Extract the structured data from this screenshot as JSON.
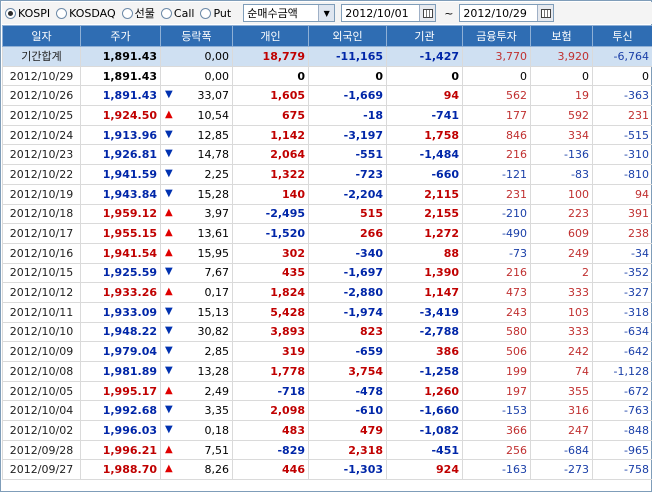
{
  "toolbar": {
    "radios": [
      {
        "label": "KOSPI",
        "selected": true
      },
      {
        "label": "KOSDAQ",
        "selected": false
      },
      {
        "label": "선물",
        "selected": false
      },
      {
        "label": "Call",
        "selected": false
      },
      {
        "label": "Put",
        "selected": false
      }
    ],
    "select_value": "순매수금액",
    "date_from": "2012/10/01",
    "tilde": "~",
    "date_to": "2012/10/29"
  },
  "colors": {
    "header_bg": "#2f6db3",
    "up": "#c00000",
    "down": "#0026a8",
    "sum_bg": "#cfe0f2"
  },
  "columns": [
    "일자",
    "주가",
    "등락폭",
    "개인",
    "외국인",
    "기관",
    "금융투자",
    "보험",
    "투신"
  ],
  "rows": [
    {
      "date": "기간합계",
      "price": "1,891.43",
      "dir": "",
      "change": "0,00",
      "indiv": "18,779",
      "foreign": "-11,165",
      "inst": "-1,427",
      "fin": "3,770",
      "ins": "3,920",
      "trust": "-6,764",
      "sum": true
    },
    {
      "date": "2012/10/29",
      "price": "1,891.43",
      "dir": "",
      "change": "0,00",
      "indiv": "0",
      "foreign": "0",
      "inst": "0",
      "fin": "0",
      "ins": "0",
      "trust": "0"
    },
    {
      "date": "2012/10/26",
      "price": "1,891.43",
      "dir": "down",
      "change": "33,07",
      "indiv": "1,605",
      "foreign": "-1,669",
      "inst": "94",
      "fin": "562",
      "ins": "19",
      "trust": "-363"
    },
    {
      "date": "2012/10/25",
      "price": "1,924.50",
      "dir": "up",
      "change": "10,54",
      "indiv": "675",
      "foreign": "-18",
      "inst": "-741",
      "fin": "177",
      "ins": "592",
      "trust": "231"
    },
    {
      "date": "2012/10/24",
      "price": "1,913.96",
      "dir": "down",
      "change": "12,85",
      "indiv": "1,142",
      "foreign": "-3,197",
      "inst": "1,758",
      "fin": "846",
      "ins": "334",
      "trust": "-515"
    },
    {
      "date": "2012/10/23",
      "price": "1,926.81",
      "dir": "down",
      "change": "14,78",
      "indiv": "2,064",
      "foreign": "-551",
      "inst": "-1,484",
      "fin": "216",
      "ins": "-136",
      "trust": "-310"
    },
    {
      "date": "2012/10/22",
      "price": "1,941.59",
      "dir": "down",
      "change": "2,25",
      "indiv": "1,322",
      "foreign": "-723",
      "inst": "-660",
      "fin": "-121",
      "ins": "-83",
      "trust": "-810"
    },
    {
      "date": "2012/10/19",
      "price": "1,943.84",
      "dir": "down",
      "change": "15,28",
      "indiv": "140",
      "foreign": "-2,204",
      "inst": "2,115",
      "fin": "231",
      "ins": "100",
      "trust": "94"
    },
    {
      "date": "2012/10/18",
      "price": "1,959.12",
      "dir": "up",
      "change": "3,97",
      "indiv": "-2,495",
      "foreign": "515",
      "inst": "2,155",
      "fin": "-210",
      "ins": "223",
      "trust": "391"
    },
    {
      "date": "2012/10/17",
      "price": "1,955.15",
      "dir": "up",
      "change": "13,61",
      "indiv": "-1,520",
      "foreign": "266",
      "inst": "1,272",
      "fin": "-490",
      "ins": "609",
      "trust": "238"
    },
    {
      "date": "2012/10/16",
      "price": "1,941.54",
      "dir": "up",
      "change": "15,95",
      "indiv": "302",
      "foreign": "-340",
      "inst": "88",
      "fin": "-73",
      "ins": "249",
      "trust": "-34"
    },
    {
      "date": "2012/10/15",
      "price": "1,925.59",
      "dir": "down",
      "change": "7,67",
      "indiv": "435",
      "foreign": "-1,697",
      "inst": "1,390",
      "fin": "216",
      "ins": "2",
      "trust": "-352"
    },
    {
      "date": "2012/10/12",
      "price": "1,933.26",
      "dir": "up",
      "change": "0,17",
      "indiv": "1,824",
      "foreign": "-2,880",
      "inst": "1,147",
      "fin": "473",
      "ins": "333",
      "trust": "-327"
    },
    {
      "date": "2012/10/11",
      "price": "1,933.09",
      "dir": "down",
      "change": "15,13",
      "indiv": "5,428",
      "foreign": "-1,974",
      "inst": "-3,419",
      "fin": "243",
      "ins": "103",
      "trust": "-318"
    },
    {
      "date": "2012/10/10",
      "price": "1,948.22",
      "dir": "down",
      "change": "30,82",
      "indiv": "3,893",
      "foreign": "823",
      "inst": "-2,788",
      "fin": "580",
      "ins": "333",
      "trust": "-634"
    },
    {
      "date": "2012/10/09",
      "price": "1,979.04",
      "dir": "down",
      "change": "2,85",
      "indiv": "319",
      "foreign": "-659",
      "inst": "386",
      "fin": "506",
      "ins": "242",
      "trust": "-642"
    },
    {
      "date": "2012/10/08",
      "price": "1,981.89",
      "dir": "down",
      "change": "13,28",
      "indiv": "1,778",
      "foreign": "3,754",
      "inst": "-1,258",
      "fin": "199",
      "ins": "74",
      "trust": "-1,128"
    },
    {
      "date": "2012/10/05",
      "price": "1,995.17",
      "dir": "up",
      "change": "2,49",
      "indiv": "-718",
      "foreign": "-478",
      "inst": "1,260",
      "fin": "197",
      "ins": "355",
      "trust": "-672"
    },
    {
      "date": "2012/10/04",
      "price": "1,992.68",
      "dir": "down",
      "change": "3,35",
      "indiv": "2,098",
      "foreign": "-610",
      "inst": "-1,660",
      "fin": "-153",
      "ins": "316",
      "trust": "-763"
    },
    {
      "date": "2012/10/02",
      "price": "1,996.03",
      "dir": "down",
      "change": "0,18",
      "indiv": "483",
      "foreign": "479",
      "inst": "-1,082",
      "fin": "366",
      "ins": "247",
      "trust": "-848"
    },
    {
      "date": "2012/09/28",
      "price": "1,996.21",
      "dir": "up",
      "change": "7,51",
      "indiv": "-829",
      "foreign": "2,318",
      "inst": "-451",
      "fin": "256",
      "ins": "-684",
      "trust": "-965"
    },
    {
      "date": "2012/09/27",
      "price": "1,988.70",
      "dir": "up",
      "change": "8,26",
      "indiv": "446",
      "foreign": "-1,303",
      "inst": "924",
      "fin": "-163",
      "ins": "-273",
      "trust": "-758"
    }
  ]
}
